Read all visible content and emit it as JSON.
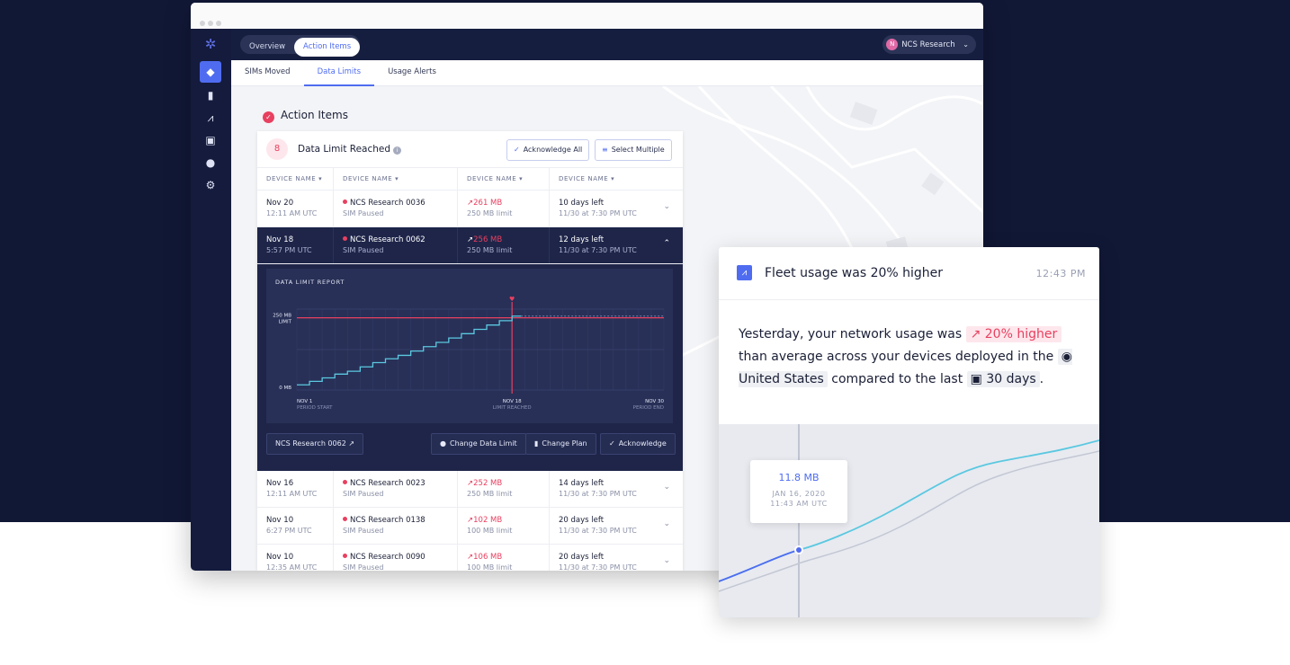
{
  "topbar": {
    "tabs": [
      {
        "label": "Overview",
        "active": false
      },
      {
        "label": "Action Items",
        "active": true
      }
    ],
    "account": {
      "initial": "N",
      "name": "NCS Research"
    }
  },
  "rail_icons": [
    "logo-icon",
    "layers-icon",
    "document-icon",
    "chart-icon",
    "camera-icon",
    "compass-icon",
    "gear-icon"
  ],
  "subtabs": [
    {
      "label": "SIMs Moved"
    },
    {
      "label": "Data Limits",
      "active": true
    },
    {
      "label": "Usage Alerts"
    }
  ],
  "section": {
    "title": "Action Items"
  },
  "card": {
    "count": "8",
    "title": "Data Limit Reached",
    "acknowledge_all": "Acknowledge All",
    "select_multiple": "Select Multiple",
    "columns": [
      "DEVICE NAME ▾",
      "DEVICE NAME ▾",
      "DEVICE NAME ▾",
      "DEVICE NAME ▾"
    ],
    "rows": [
      {
        "date": "Nov 20",
        "time": "12:11 AM UTC",
        "device": "NCS Research 0036",
        "status": "SIM Paused",
        "usage": "261 MB",
        "limit": "250 MB limit",
        "days": "10 days left",
        "until": "11/30 at 7:30 PM UTC"
      },
      {
        "date": "Nov 18",
        "time": "5:57 PM UTC",
        "device": "NCS Research 0062",
        "status": "SIM Paused",
        "usage": "256 MB",
        "limit": "250 MB limit",
        "days": "12 days left",
        "until": "11/30 at 7:30 PM UTC"
      },
      {
        "date": "Nov 16",
        "time": "12:11 AM UTC",
        "device": "NCS Research 0023",
        "status": "SIM Paused",
        "usage": "252 MB",
        "limit": "250 MB limit",
        "days": "14 days left",
        "until": "11/30 at 7:30 PM UTC"
      },
      {
        "date": "Nov 10",
        "time": "6:27 PM UTC",
        "device": "NCS Research 0138",
        "status": "SIM Paused",
        "usage": "102 MB",
        "limit": "100 MB limit",
        "days": "20 days left",
        "until": "11/30 at 7:30 PM UTC"
      },
      {
        "date": "Nov 10",
        "time": "12:35 AM UTC",
        "device": "NCS Research 0090",
        "status": "SIM Paused",
        "usage": "106 MB",
        "limit": "100 MB limit",
        "days": "20 days left",
        "until": "11/30 at 7:30 PM UTC"
      }
    ],
    "report": {
      "title": "DATA LIMIT REPORT",
      "limit_label_1": "250 MB",
      "limit_label_2": "LIMIT",
      "zero_label": "0 MB",
      "x_labels": [
        {
          "date": "NOV 1",
          "caption": "PERIOD START"
        },
        {
          "date": "NOV 18",
          "caption": "LIMIT REACHED"
        },
        {
          "date": "NOV 30",
          "caption": "PERIOD END"
        }
      ]
    },
    "expanded_actions": {
      "device_link": "NCS Research 0062 ↗",
      "change_limit": "Change Data Limit",
      "change_plan": "Change Plan",
      "acknowledge": "Acknowledge"
    }
  },
  "chart_data": {
    "type": "line",
    "title": "DATA LIMIT REPORT",
    "x_tick_labels": [
      "NOV 1",
      "NOV 18",
      "NOV 30"
    ],
    "y_tick_labels": [
      "0 MB",
      "250 MB LIMIT"
    ],
    "ylim": [
      0,
      280
    ],
    "limit_line": 250,
    "limit_reached_day": 18,
    "series": [
      {
        "x": [
          1,
          2,
          3,
          4,
          5,
          6,
          7,
          8,
          9,
          10,
          11,
          12,
          13,
          14,
          15,
          16,
          17,
          18
        ],
        "values": [
          18,
          30,
          42,
          55,
          65,
          80,
          95,
          108,
          120,
          135,
          150,
          165,
          180,
          195,
          210,
          225,
          240,
          256
        ]
      }
    ]
  },
  "popup": {
    "title": "Fleet usage was 20% higher",
    "time": "12:43 PM",
    "body_1": "Yesterday, your network usage was",
    "highlight": "↗ 20% higher",
    "body_2": "than average across your devices deployed in the",
    "country": "United States",
    "body_3": "compared to the last",
    "period": "30 days",
    "body_4": ".",
    "tooltip": {
      "value": "11.8 MB",
      "date": "JAN 16, 2020",
      "time": "11:43 AM UTC"
    }
  },
  "colors": {
    "navy": "#111836",
    "accent": "#4f6cf0",
    "alert": "#e84060",
    "series": "#5bc8e0"
  }
}
